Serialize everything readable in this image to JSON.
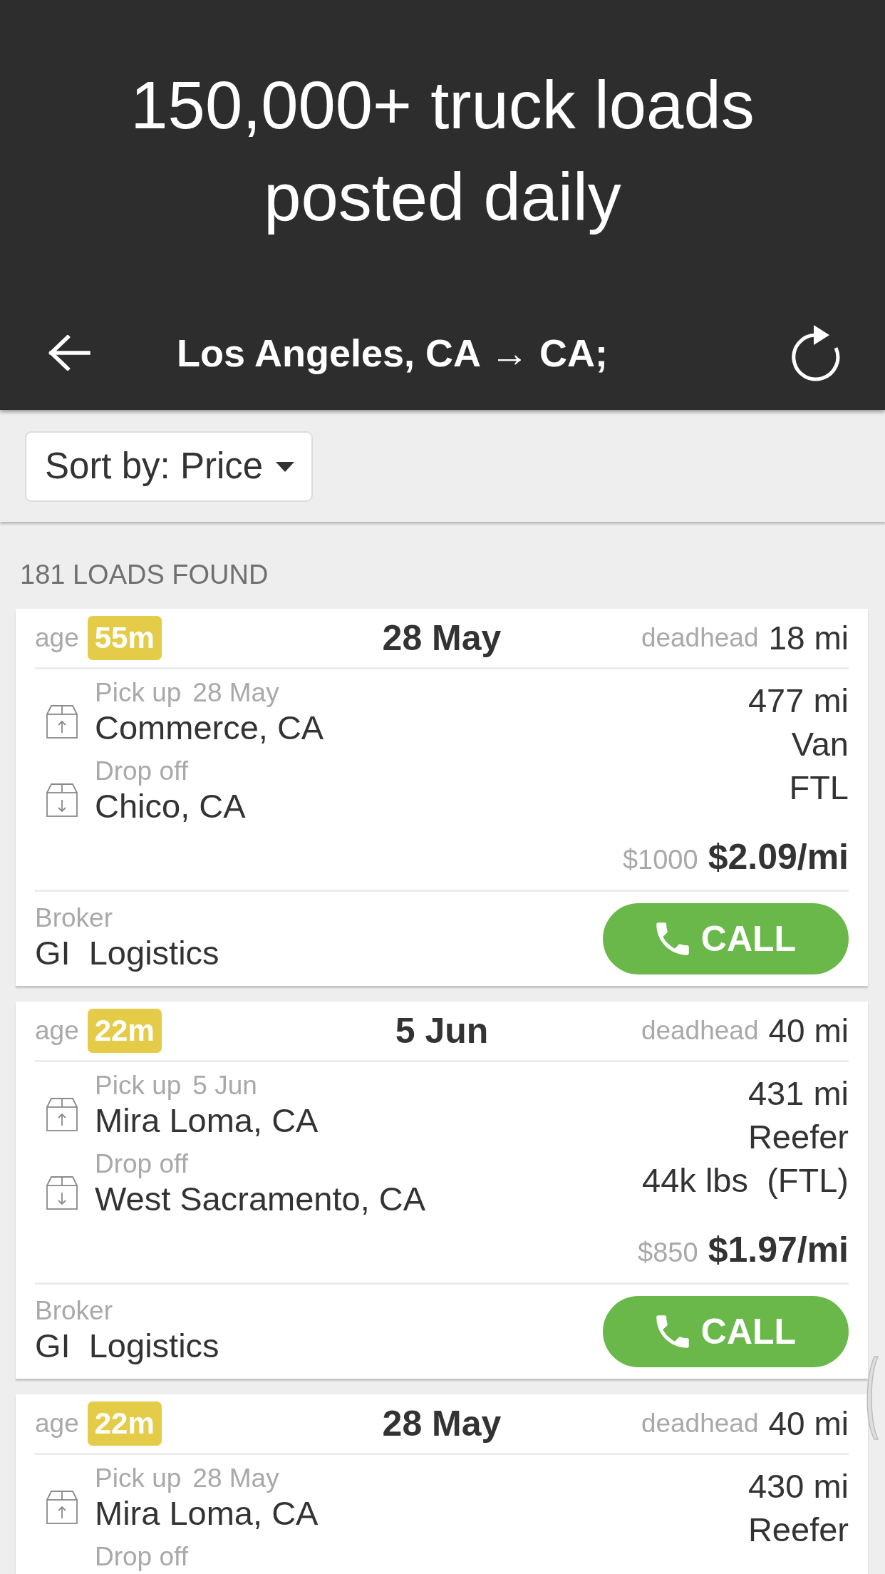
{
  "header": {
    "headline": "150,000+ truck loads posted daily"
  },
  "toolbar": {
    "title": "Los Angeles, CA → CA;"
  },
  "sort": {
    "label": "Sort by: Price"
  },
  "results_count": "181 LOADS FOUND",
  "loads": [
    {
      "age_label": "age",
      "age": "55m",
      "date": "28 May",
      "deadhead_label": "deadhead",
      "deadhead": "18 mi",
      "stops": [
        {
          "kind": "pickup",
          "label": "Pick up",
          "date": "28 May",
          "city": "Commerce, CA"
        },
        {
          "kind": "dropoff",
          "label": "Drop off",
          "city": "Chico, CA"
        }
      ],
      "details": [
        "477 mi",
        "Van",
        "FTL"
      ],
      "total": "$1000",
      "rate": "$2.09/mi",
      "broker_label": "Broker",
      "broker": "GI  Logistics",
      "call_label": "CALL"
    },
    {
      "age_label": "age",
      "age": "22m",
      "date": "5 Jun",
      "deadhead_label": "deadhead",
      "deadhead": "40 mi",
      "stops": [
        {
          "kind": "pickup",
          "label": "Pick up",
          "date": "5 Jun",
          "city": "Mira Loma, CA"
        },
        {
          "kind": "dropoff",
          "label": "Drop off",
          "city": "West Sacramento, CA"
        }
      ],
      "details": [
        "431 mi",
        "Reefer",
        "44k lbs  (FTL)"
      ],
      "total": "$850",
      "rate": "$1.97/mi",
      "broker_label": "Broker",
      "broker": "GI  Logistics",
      "call_label": "CALL"
    },
    {
      "age_label": "age",
      "age": "22m",
      "date": "28 May",
      "deadhead_label": "deadhead",
      "deadhead": "40 mi",
      "stops": [
        {
          "kind": "pickup",
          "label": "Pick up",
          "date": "28 May",
          "city": "Mira Loma, CA"
        },
        {
          "kind": "dropoff",
          "label": "Drop off"
        }
      ],
      "details": [
        "430 mi",
        "Reefer"
      ]
    }
  ]
}
